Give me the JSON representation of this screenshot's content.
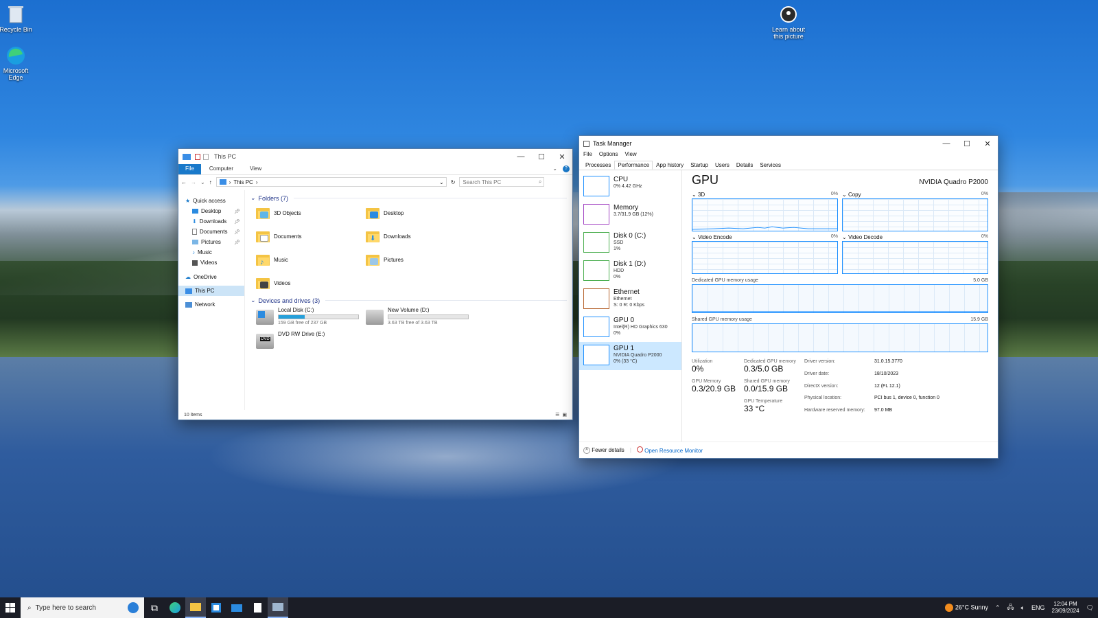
{
  "desktop": {
    "icons": [
      {
        "label": "Recycle Bin"
      },
      {
        "label": "Microsoft Edge"
      },
      {
        "label": "Learn about this picture"
      }
    ]
  },
  "explorer": {
    "title": "This PC",
    "ribbon_tabs": [
      "File",
      "Computer",
      "View"
    ],
    "address": "This PC",
    "search_placeholder": "Search This PC",
    "nav": {
      "quick_access": "Quick access",
      "pinned": [
        "Desktop",
        "Downloads",
        "Documents",
        "Pictures"
      ],
      "unpinned": [
        "Music",
        "Videos"
      ],
      "onedrive": "OneDrive",
      "this_pc": "This PC",
      "network": "Network"
    },
    "folders_header": "Folders (7)",
    "folders": [
      "3D Objects",
      "Desktop",
      "Documents",
      "Downloads",
      "Music",
      "Pictures",
      "Videos"
    ],
    "devices_header": "Devices and drives (3)",
    "drives": [
      {
        "name": "Local Disk (C:)",
        "free": "159 GB free of 237 GB",
        "used_fraction": 0.33
      },
      {
        "name": "New Volume (D:)",
        "free": "3.63 TB free of 3.63 TB",
        "used_fraction": 0.0
      },
      {
        "name": "DVD RW Drive (E:)",
        "badge": "DVD"
      }
    ],
    "status": "10 items"
  },
  "taskmgr": {
    "title": "Task Manager",
    "menu": [
      "File",
      "Options",
      "View"
    ],
    "tabs": [
      "Processes",
      "Performance",
      "App history",
      "Startup",
      "Users",
      "Details",
      "Services"
    ],
    "active_tab": "Performance",
    "perf_items": [
      {
        "title": "CPU",
        "sub1": "0% 4.42 GHz",
        "sub2": "",
        "color": "#1e90ff"
      },
      {
        "title": "Memory",
        "sub1": "3.7/31.9 GB (12%)",
        "sub2": "",
        "color": "#a142c2"
      },
      {
        "title": "Disk 0 (C:)",
        "sub1": "SSD",
        "sub2": "1%",
        "color": "#4caf50"
      },
      {
        "title": "Disk 1 (D:)",
        "sub1": "HDD",
        "sub2": "0%",
        "color": "#4caf50"
      },
      {
        "title": "Ethernet",
        "sub1": "Ethernet",
        "sub2": "S: 0 R: 0 Kbps",
        "color": "#b5622c"
      },
      {
        "title": "GPU 0",
        "sub1": "Intel(R) HD Graphics 630",
        "sub2": "0%",
        "color": "#1e90ff"
      },
      {
        "title": "GPU 1",
        "sub1": "NVIDIA Quadro P2000",
        "sub2": "0% (33 °C)",
        "color": "#1e90ff"
      }
    ],
    "gpu": {
      "heading": "GPU",
      "model": "NVIDIA Quadro P2000",
      "engines": [
        {
          "name": "3D",
          "pct": "0%"
        },
        {
          "name": "Copy",
          "pct": "0%"
        },
        {
          "name": "Video Encode",
          "pct": "0%"
        },
        {
          "name": "Video Decode",
          "pct": "0%"
        }
      ],
      "dedicated_label": "Dedicated GPU memory usage",
      "dedicated_max": "5.0 GB",
      "shared_label": "Shared GPU memory usage",
      "shared_max": "15.9 GB",
      "utilization_label": "Utilization",
      "utilization": "0%",
      "dedicated_mem_label": "Dedicated GPU memory",
      "dedicated_mem": "0.3/5.0 GB",
      "gpu_mem_label": "GPU Memory",
      "gpu_mem": "0.3/20.9 GB",
      "shared_mem_label": "Shared GPU memory",
      "shared_mem": "0.0/15.9 GB",
      "temp_label": "GPU Temperature",
      "temp": "33 °C",
      "details": [
        {
          "k": "Driver version:",
          "v": "31.0.15.3770"
        },
        {
          "k": "Driver date:",
          "v": "18/10/2023"
        },
        {
          "k": "DirectX version:",
          "v": "12 (FL 12.1)"
        },
        {
          "k": "Physical location:",
          "v": "PCI bus 1, device 0, function 0"
        },
        {
          "k": "Hardware reserved memory:",
          "v": "97.0 MB"
        }
      ]
    },
    "fewer_details": "Fewer details",
    "open_monitor": "Open Resource Monitor"
  },
  "taskbar": {
    "search_placeholder": "Type here to search",
    "weather": "26°C  Sunny",
    "lang": "ENG",
    "time": "12:04 PM",
    "date": "23/09/2024"
  }
}
